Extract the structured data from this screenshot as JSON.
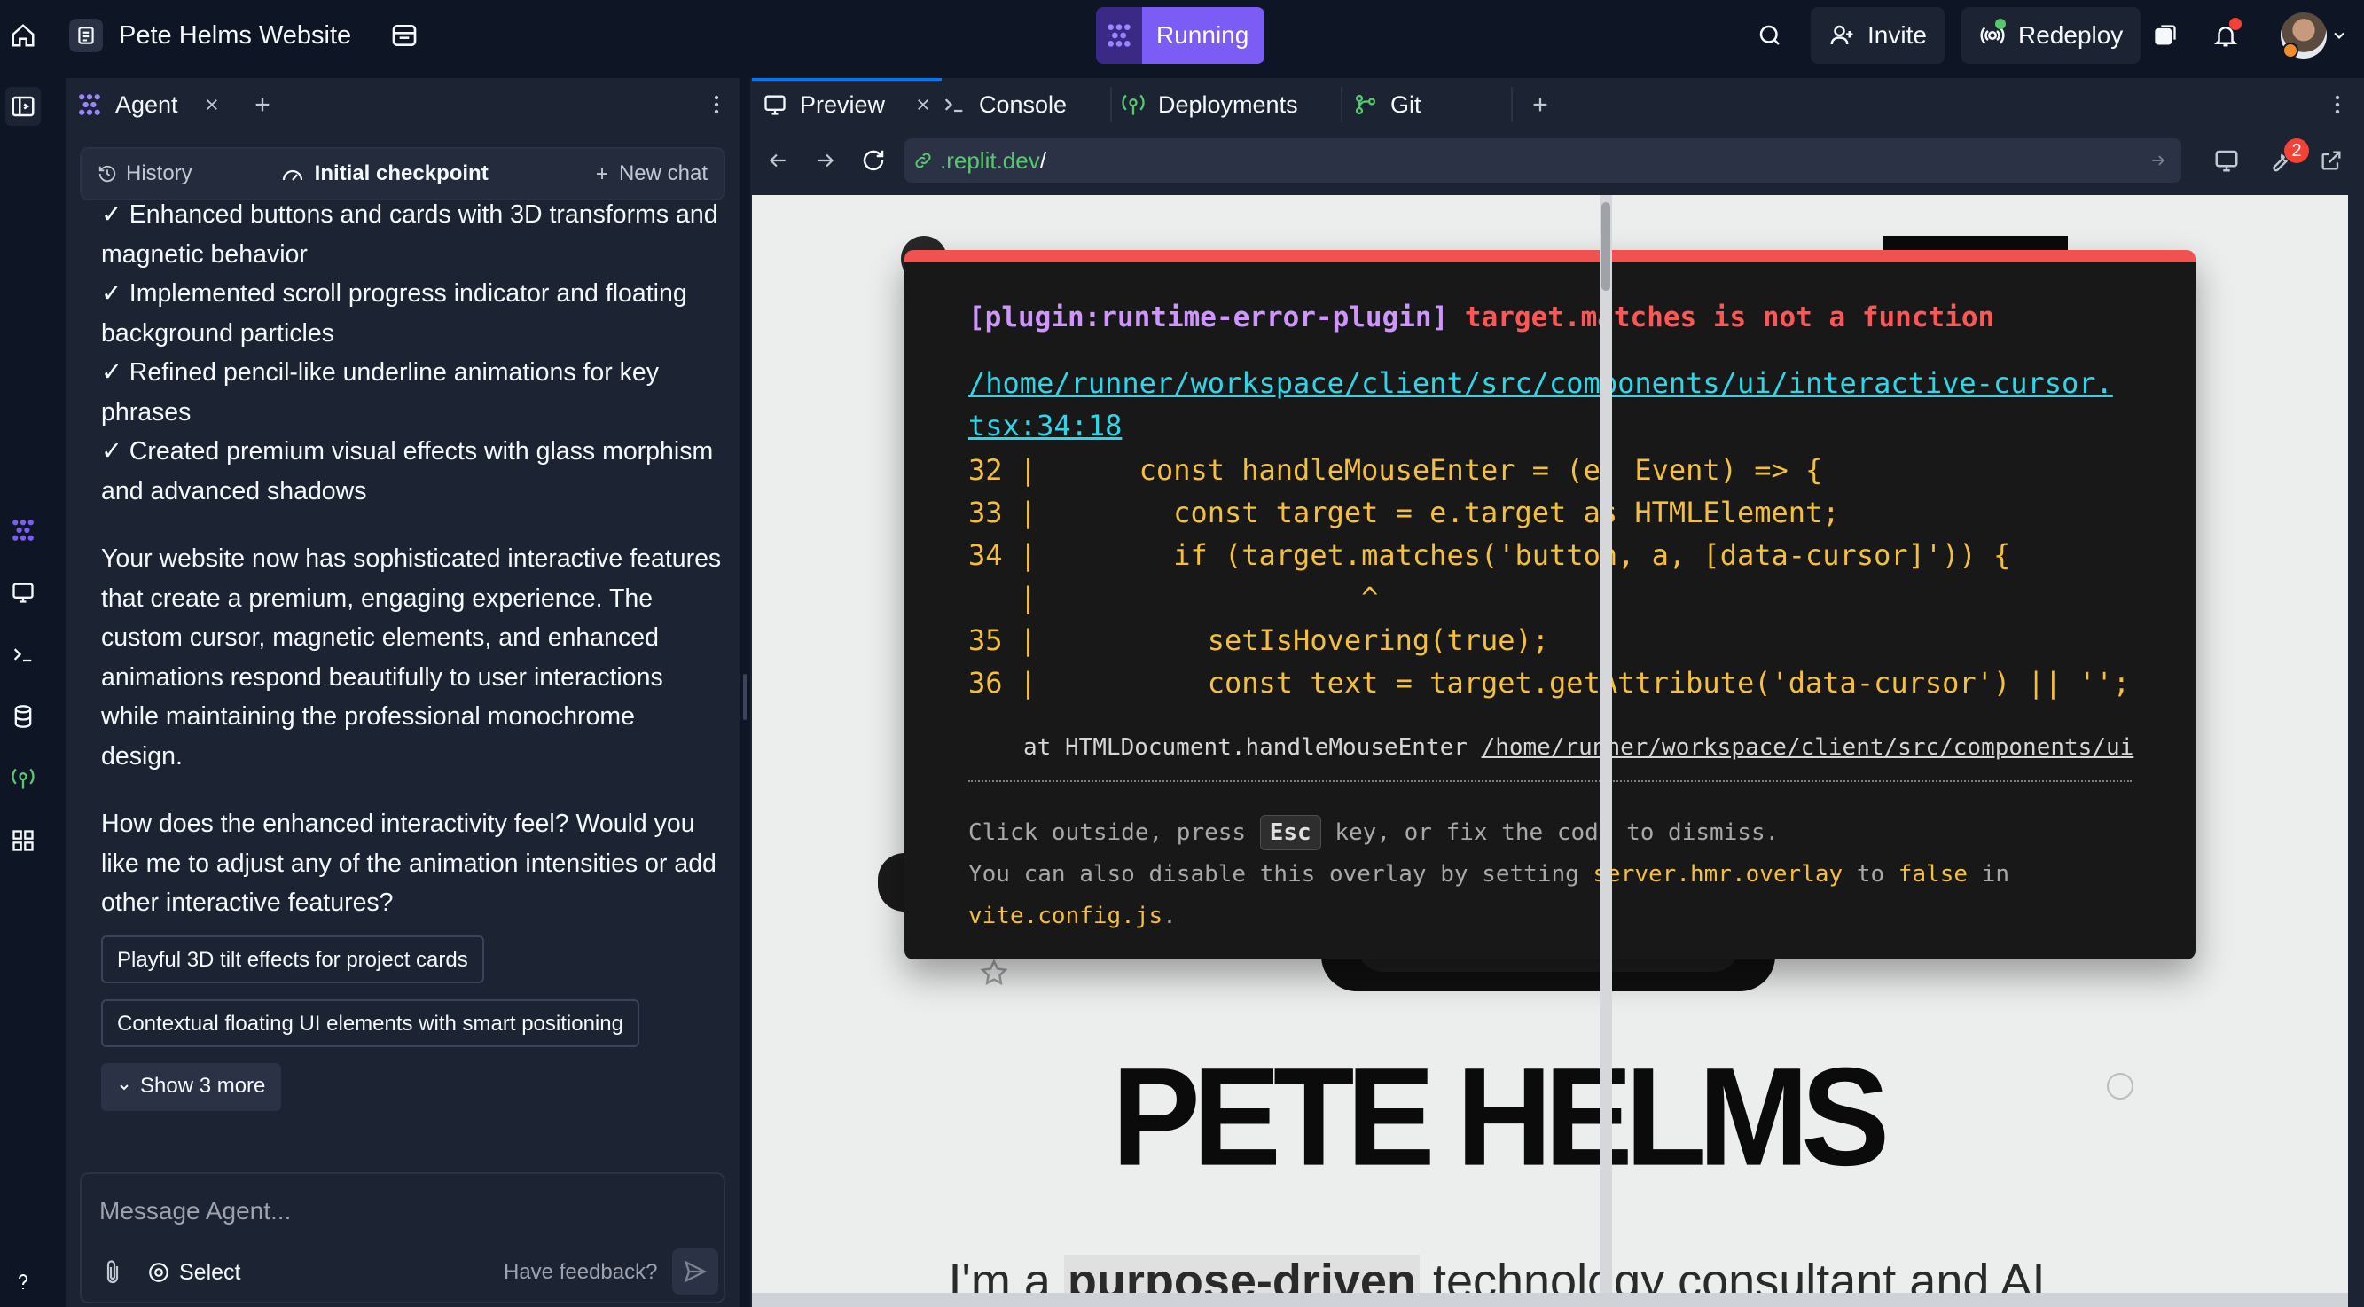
{
  "topbar": {
    "project_name": "Pete Helms Website",
    "run_label": "Running",
    "invite_label": "Invite",
    "redeploy_label": "Redeploy"
  },
  "agent_panel": {
    "tab_label": "Agent",
    "toolbar": {
      "history_label": "History",
      "checkpoint_label": "Initial checkpoint",
      "new_chat_label": "New chat"
    },
    "messages": {
      "bullets": [
        "✓ Enhanced buttons and cards with 3D transforms and magnetic behavior",
        "✓ Implemented scroll progress indicator and floating background particles",
        "✓ Refined pencil-like underline animations for key phrases",
        "✓ Created premium visual effects with glass morphism and advanced shadows"
      ],
      "summary": "Your website now has sophisticated interactive features that create a premium, engaging experience. The custom cursor, magnetic elements, and enhanced animations respond beautifully to user interactions while maintaining the professional monochrome design.",
      "question": "How does the enhanced interactivity feel? Would you like me to adjust any of the animation intensities or add other interactive features?"
    },
    "suggestions": [
      "Playful 3D tilt effects for project cards",
      "Contextual floating UI elements with smart positioning"
    ],
    "show_more_label": "Show 3 more",
    "composer": {
      "placeholder": "Message Agent...",
      "select_label": "Select",
      "feedback_label": "Have feedback?"
    }
  },
  "workspace": {
    "tabs": [
      "Preview",
      "Console",
      "Deployments",
      "Git"
    ],
    "url": {
      "domain": ".replit.dev",
      "path": "/"
    },
    "notification_count": "2"
  },
  "error_overlay": {
    "plugin": "[plugin:runtime-error-plugin]",
    "message": "target.matches is not a function",
    "file": "/home/runner/workspace/client/src/components/ui/interactive-cursor.tsx:34:18",
    "code_lines": [
      "32 |      const handleMouseEnter = (e: Event) => {",
      "33 |        const target = e.target as HTMLElement;",
      "34 |        if (target.matches('button, a, [data-cursor]')) {",
      "   |                   ^",
      "35 |          setIsHovering(true);",
      "36 |          const text = target.getAttribute('data-cursor') || '';"
    ],
    "stack_prefix": "at HTMLDocument.handleMouseEnter",
    "stack_path": "/home/runner/workspace/client/src/components/ui",
    "tip": {
      "click_outside": "Click outside, press",
      "esc_key": "Esc",
      "after_key": "key, or fix the code to dismiss.",
      "disable_prefix": "You can also disable this overlay by setting",
      "setting": "server.hmr.overlay",
      "to": "to",
      "false_value": "false",
      "in": "in",
      "config_file": "vite.config.js",
      "period": "."
    }
  },
  "preview_page": {
    "title": "PETE HELMS",
    "subtitle_pre": "I'm a",
    "subtitle_bold": "purpose-driven",
    "subtitle_post": "technology consultant and AI"
  },
  "colors": {
    "bg": "#0e1525",
    "panel": "#1c2333",
    "accent_purple": "#7b5cf5",
    "url_green": "#58c86f",
    "error_red": "#f05252"
  }
}
